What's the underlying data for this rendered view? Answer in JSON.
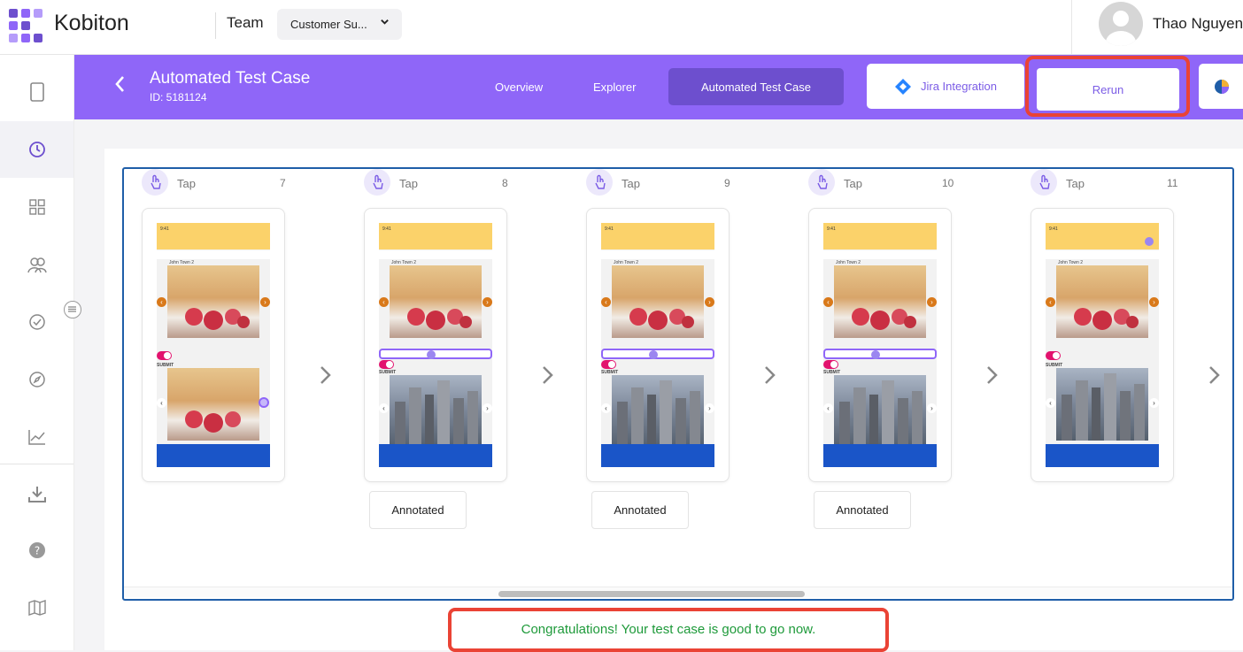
{
  "app": {
    "name": "Kobiton"
  },
  "topbar": {
    "team_label": "Team",
    "team_select": "Customer Su...",
    "user_name": "Thao Nguyen"
  },
  "sidebar": {
    "items": [
      {
        "icon": "device-icon"
      },
      {
        "icon": "clock-icon",
        "active": true
      },
      {
        "icon": "grid-icon"
      },
      {
        "icon": "users-icon"
      },
      {
        "icon": "check-circle-icon"
      },
      {
        "icon": "compass-icon"
      },
      {
        "icon": "line-chart-icon"
      },
      {
        "icon": "download-icon"
      },
      {
        "icon": "help-icon"
      },
      {
        "icon": "map-icon"
      }
    ]
  },
  "header": {
    "title": "Automated Test Case",
    "id_text": "ID: 5181124",
    "tabs": [
      "Overview",
      "Explorer",
      "Automated Test Case"
    ],
    "active_tab": "Automated Test Case",
    "jira_label": "Jira Integration",
    "rerun_label": "Rerun"
  },
  "steps": [
    {
      "action": "Tap",
      "number": "7",
      "annotated": null
    },
    {
      "action": "Tap",
      "number": "8",
      "annotated": "Annotated"
    },
    {
      "action": "Tap",
      "number": "9",
      "annotated": "Annotated"
    },
    {
      "action": "Tap",
      "number": "10",
      "annotated": "Annotated"
    },
    {
      "action": "Tap",
      "number": "11",
      "annotated": null
    }
  ],
  "phone_screen": {
    "time": "9:41",
    "input_placeholder": "Input your text",
    "carousel_label": "John Town 2",
    "submit": "SUBMIT",
    "city_label": "John Town 3"
  },
  "footer": {
    "message": "Congratulations! Your test case is good to go now."
  },
  "colors": {
    "brand": "#8f66f8",
    "accent_dark": "#6d4fce",
    "highlight": "#ea4335",
    "success": "#1e9a3a"
  }
}
